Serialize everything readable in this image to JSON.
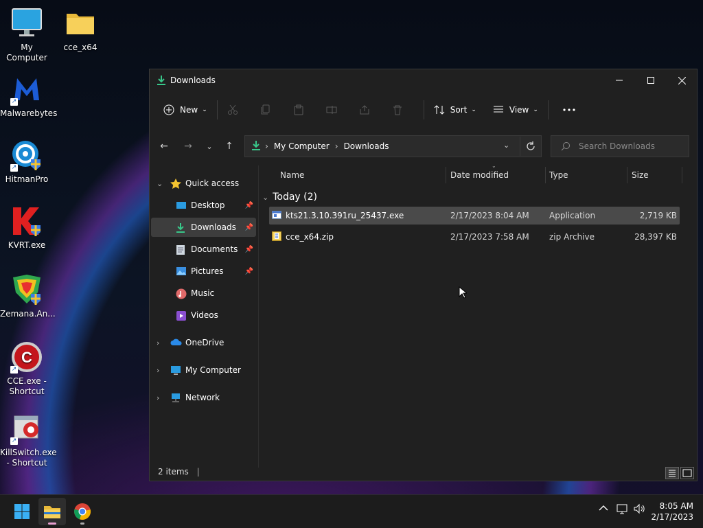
{
  "desktop": {
    "icons": [
      {
        "label": "My Computer",
        "icon": "monitor-icon"
      },
      {
        "label": "cce_x64",
        "icon": "folder-icon"
      },
      {
        "label": "Malwarebytes",
        "icon": "malwarebytes-icon"
      },
      {
        "label": "HitmanPro",
        "icon": "hitmanpro-icon"
      },
      {
        "label": "KVRT.exe",
        "icon": "kvrt-icon"
      },
      {
        "label": "Zemana.An...",
        "icon": "zemana-icon"
      },
      {
        "label": "CCE.exe - Shortcut",
        "icon": "cce-icon"
      },
      {
        "label": "KillSwitch.exe - Shortcut",
        "icon": "killswitch-icon"
      }
    ]
  },
  "window": {
    "title": "Downloads",
    "toolbar": {
      "new_label": "New",
      "sort_label": "Sort",
      "view_label": "View"
    },
    "address": {
      "path": [
        "My Computer",
        "Downloads"
      ]
    },
    "search": {
      "placeholder": "Search Downloads"
    },
    "nav": {
      "quick_access": "Quick access",
      "items": [
        {
          "label": "Desktop",
          "icon": "desktop-icon",
          "pinned": true
        },
        {
          "label": "Downloads",
          "icon": "download-icon",
          "pinned": true,
          "selected": true
        },
        {
          "label": "Documents",
          "icon": "documents-icon",
          "pinned": true
        },
        {
          "label": "Pictures",
          "icon": "pictures-icon",
          "pinned": true
        },
        {
          "label": "Music",
          "icon": "music-icon",
          "pinned": false
        },
        {
          "label": "Videos",
          "icon": "videos-icon",
          "pinned": false
        }
      ],
      "roots": [
        {
          "label": "OneDrive",
          "icon": "cloud-icon"
        },
        {
          "label": "My Computer",
          "icon": "monitor-icon"
        },
        {
          "label": "Network",
          "icon": "network-icon"
        }
      ]
    },
    "columns": {
      "name": "Name",
      "date": "Date modified",
      "type": "Type",
      "size": "Size"
    },
    "group": "Today (2)",
    "files": [
      {
        "name": "kts21.3.10.391ru_25437.exe",
        "date": "2/17/2023 8:04 AM",
        "type": "Application",
        "size": "2,719 KB",
        "icon": "exe-icon"
      },
      {
        "name": "cce_x64.zip",
        "date": "2/17/2023 7:58 AM",
        "type": "zip Archive",
        "size": "28,397 KB",
        "icon": "zip-icon"
      }
    ],
    "status": {
      "count": "2 items"
    }
  },
  "taskbar": {
    "time": "8:05 AM",
    "date": "2/17/2023"
  }
}
